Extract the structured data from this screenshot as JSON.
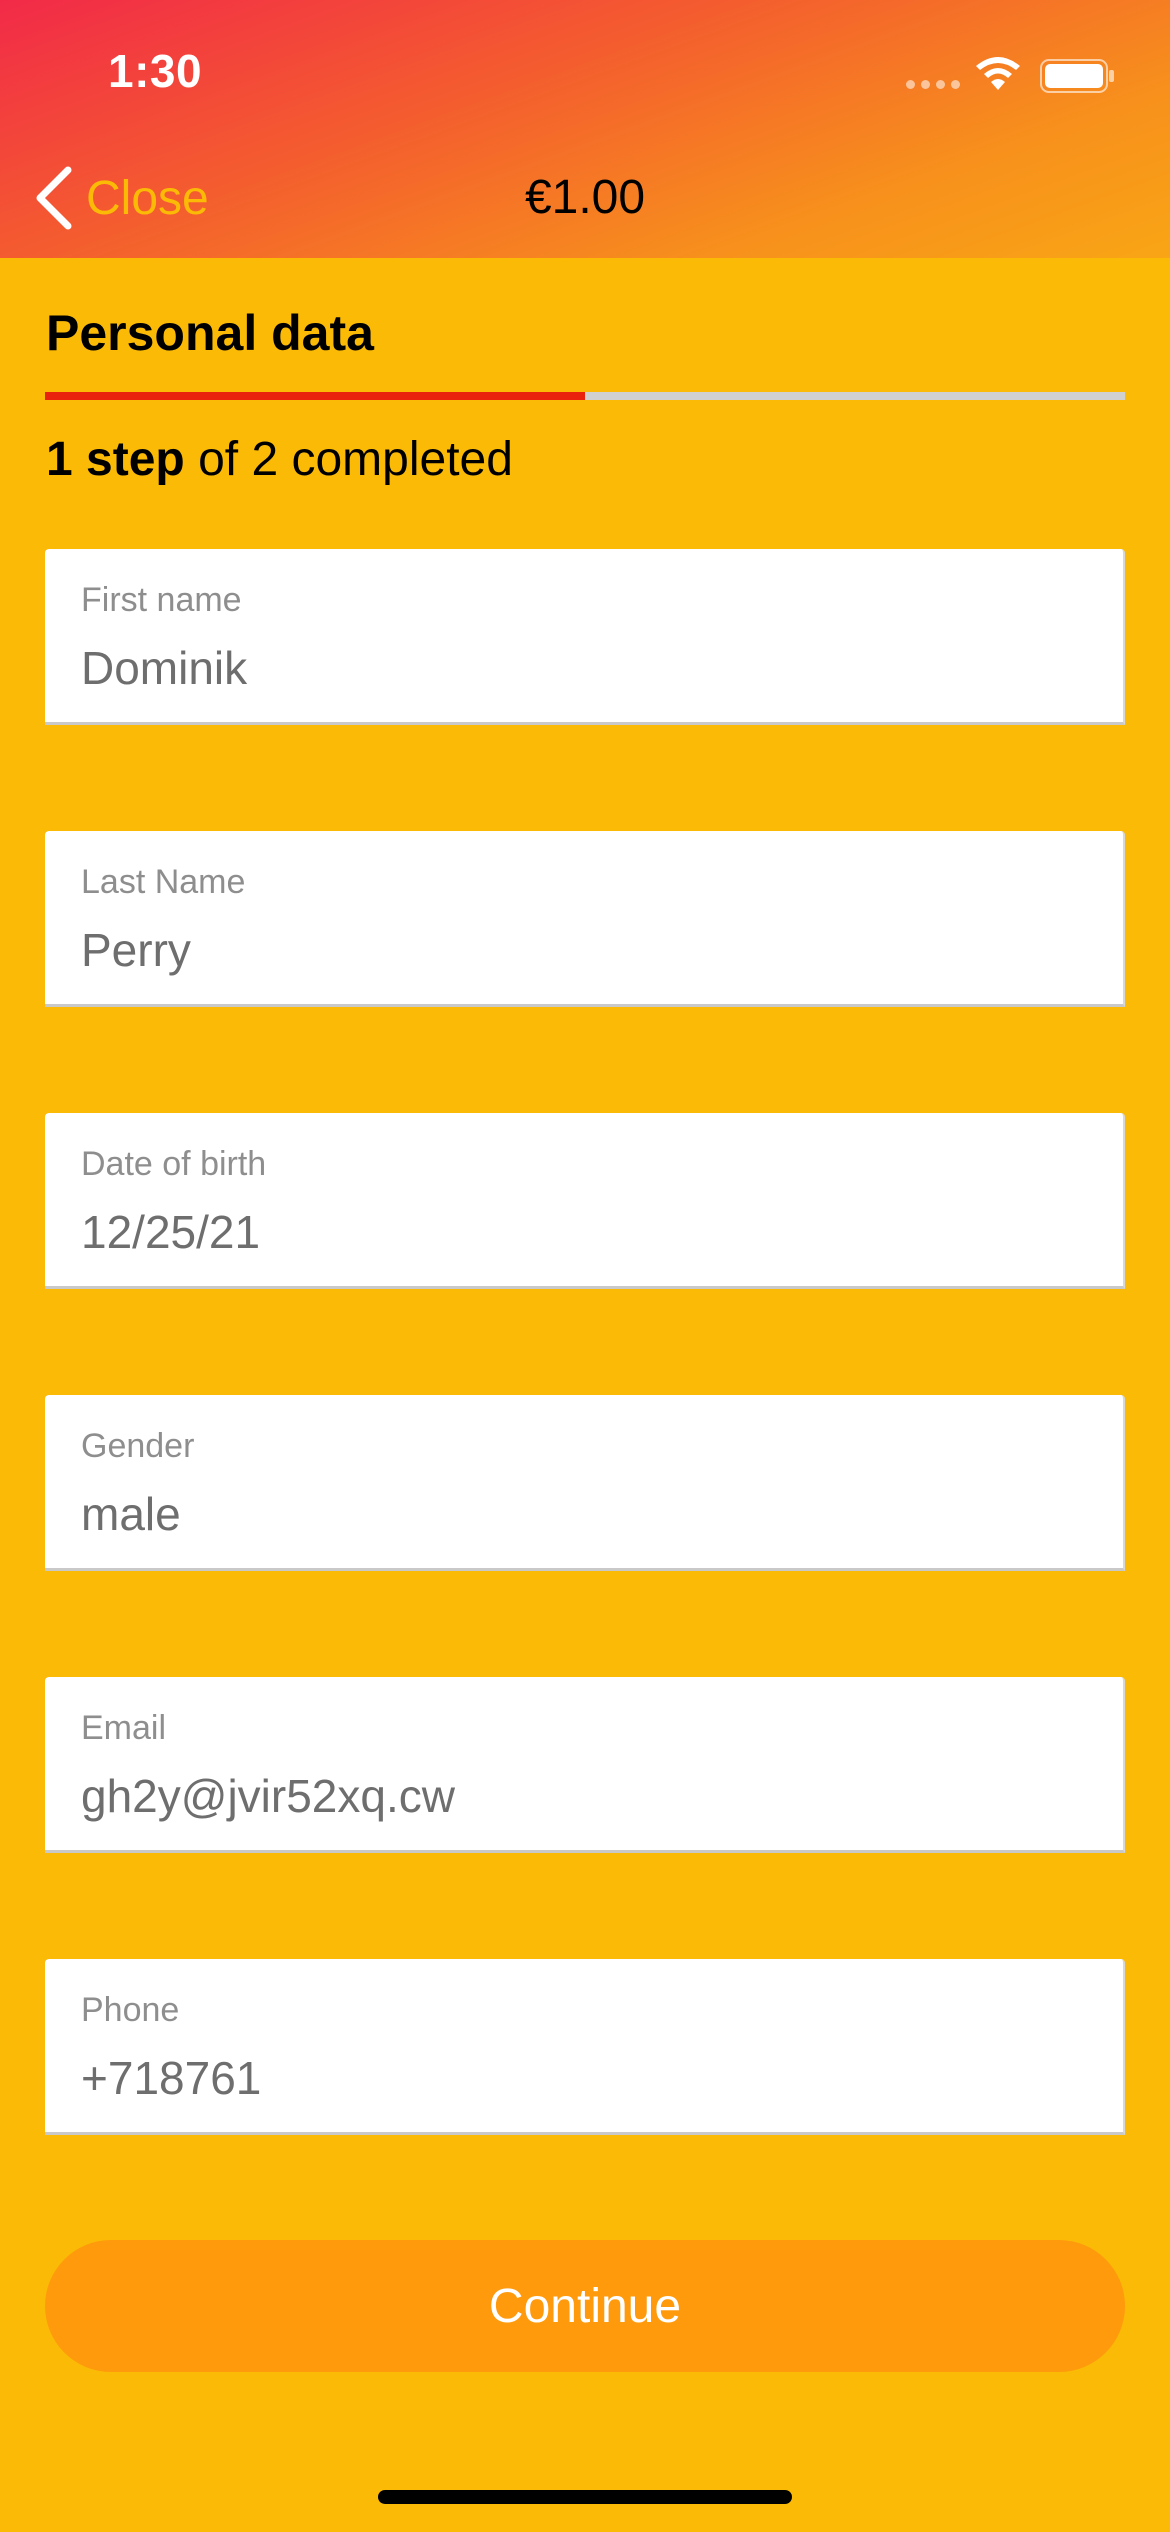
{
  "status_bar": {
    "time": "1:30"
  },
  "nav": {
    "back_label": "Close",
    "title": "€1.00"
  },
  "section": {
    "title": "Personal data"
  },
  "progress": {
    "step_bold": "1 step",
    "step_rest": " of 2 completed",
    "fraction_completed": 0.5
  },
  "fields": [
    {
      "label": "First name",
      "value": "Dominik"
    },
    {
      "label": "Last Name",
      "value": "Perry"
    },
    {
      "label": "Date of birth",
      "value": "12/25/21"
    },
    {
      "label": "Gender",
      "value": "male"
    },
    {
      "label": "Email",
      "value": "gh2y@jvir52xq.cw"
    },
    {
      "label": "Phone",
      "value": "+718761"
    }
  ],
  "actions": {
    "continue_label": "Continue"
  },
  "colors": {
    "background": "#FBBA06",
    "accent": "#FF9A0C",
    "progress_fill": "#E8220D",
    "progress_track": "#D0D0D0"
  }
}
